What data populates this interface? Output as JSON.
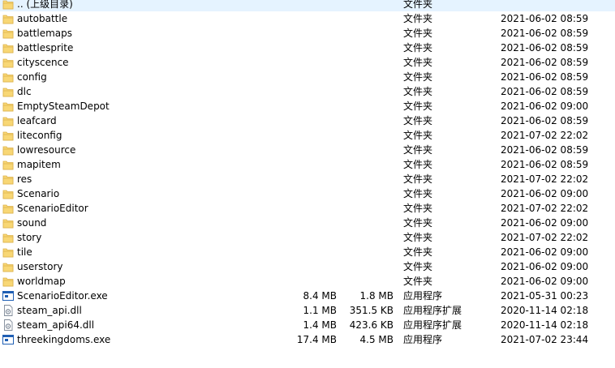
{
  "files": [
    {
      "name": ".. (上级目录)",
      "size": "",
      "packed": "",
      "type": "文件夹",
      "modified": "",
      "icon": "folder-icon"
    },
    {
      "name": "autobattle",
      "size": "",
      "packed": "",
      "type": "文件夹",
      "modified": "2021-06-02 08:59",
      "icon": "folder-icon"
    },
    {
      "name": "battlemaps",
      "size": "",
      "packed": "",
      "type": "文件夹",
      "modified": "2021-06-02 08:59",
      "icon": "folder-icon"
    },
    {
      "name": "battlesprite",
      "size": "",
      "packed": "",
      "type": "文件夹",
      "modified": "2021-06-02 08:59",
      "icon": "folder-icon"
    },
    {
      "name": "cityscence",
      "size": "",
      "packed": "",
      "type": "文件夹",
      "modified": "2021-06-02 08:59",
      "icon": "folder-icon"
    },
    {
      "name": "config",
      "size": "",
      "packed": "",
      "type": "文件夹",
      "modified": "2021-06-02 08:59",
      "icon": "folder-icon"
    },
    {
      "name": "dlc",
      "size": "",
      "packed": "",
      "type": "文件夹",
      "modified": "2021-06-02 08:59",
      "icon": "folder-icon"
    },
    {
      "name": "EmptySteamDepot",
      "size": "",
      "packed": "",
      "type": "文件夹",
      "modified": "2021-06-02 09:00",
      "icon": "folder-icon"
    },
    {
      "name": "leafcard",
      "size": "",
      "packed": "",
      "type": "文件夹",
      "modified": "2021-06-02 08:59",
      "icon": "folder-icon"
    },
    {
      "name": "liteconfig",
      "size": "",
      "packed": "",
      "type": "文件夹",
      "modified": "2021-07-02 22:02",
      "icon": "folder-icon"
    },
    {
      "name": "lowresource",
      "size": "",
      "packed": "",
      "type": "文件夹",
      "modified": "2021-06-02 08:59",
      "icon": "folder-icon"
    },
    {
      "name": "mapitem",
      "size": "",
      "packed": "",
      "type": "文件夹",
      "modified": "2021-06-02 08:59",
      "icon": "folder-icon"
    },
    {
      "name": "res",
      "size": "",
      "packed": "",
      "type": "文件夹",
      "modified": "2021-07-02 22:02",
      "icon": "folder-icon"
    },
    {
      "name": "Scenario",
      "size": "",
      "packed": "",
      "type": "文件夹",
      "modified": "2021-06-02 09:00",
      "icon": "folder-icon"
    },
    {
      "name": "ScenarioEditor",
      "size": "",
      "packed": "",
      "type": "文件夹",
      "modified": "2021-07-02 22:02",
      "icon": "folder-icon"
    },
    {
      "name": "sound",
      "size": "",
      "packed": "",
      "type": "文件夹",
      "modified": "2021-06-02 09:00",
      "icon": "folder-icon"
    },
    {
      "name": "story",
      "size": "",
      "packed": "",
      "type": "文件夹",
      "modified": "2021-07-02 22:02",
      "icon": "folder-icon"
    },
    {
      "name": "tile",
      "size": "",
      "packed": "",
      "type": "文件夹",
      "modified": "2021-06-02 09:00",
      "icon": "folder-icon"
    },
    {
      "name": "userstory",
      "size": "",
      "packed": "",
      "type": "文件夹",
      "modified": "2021-06-02 09:00",
      "icon": "folder-icon"
    },
    {
      "name": "worldmap",
      "size": "",
      "packed": "",
      "type": "文件夹",
      "modified": "2021-06-02 09:00",
      "icon": "folder-icon"
    },
    {
      "name": "ScenarioEditor.exe",
      "size": "8.4 MB",
      "packed": "1.8 MB",
      "type": "应用程序",
      "modified": "2021-05-31 00:23",
      "icon": "exe-icon"
    },
    {
      "name": "steam_api.dll",
      "size": "1.1 MB",
      "packed": "351.5 KB",
      "type": "应用程序扩展",
      "modified": "2020-11-14 02:18",
      "icon": "dll-icon"
    },
    {
      "name": "steam_api64.dll",
      "size": "1.4 MB",
      "packed": "423.6 KB",
      "type": "应用程序扩展",
      "modified": "2020-11-14 02:18",
      "icon": "dll-icon"
    },
    {
      "name": "threekingdoms.exe",
      "size": "17.4 MB",
      "packed": "4.5 MB",
      "type": "应用程序",
      "modified": "2021-07-02 23:44",
      "icon": "exe-icon"
    }
  ],
  "colors": {
    "folder_fill": "#f8d775",
    "folder_edge": "#dcb14a",
    "exe_frame": "#1f5fb4",
    "dll_frame": "#7f8a99"
  }
}
